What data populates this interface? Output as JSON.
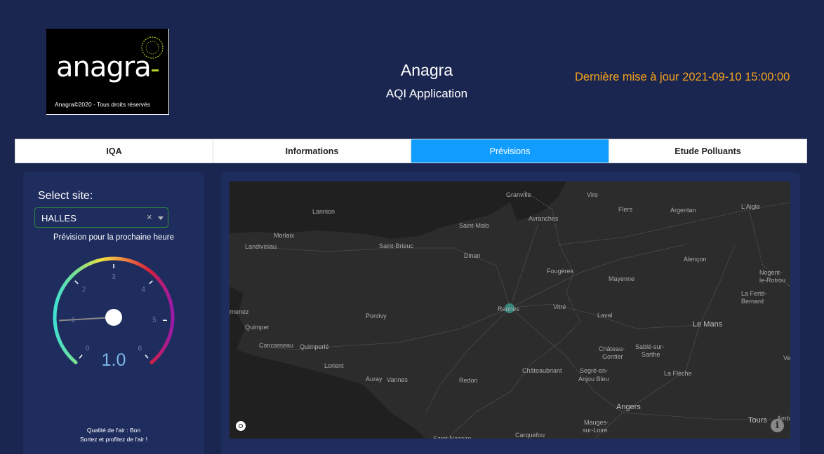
{
  "header": {
    "logo": {
      "wordmark": "anagra",
      "copyright": "Anagra©2020 -  Tous droits réservés"
    },
    "title": "Anagra",
    "subtitle": "AQI Application",
    "last_update": "Dernière mise à jour 2021-09-10 15:00:00"
  },
  "tabs": [
    {
      "label": "IQA",
      "active": false
    },
    {
      "label": "Informations",
      "active": false
    },
    {
      "label": "Prévisions",
      "active": true
    },
    {
      "label": "Etude Polluants",
      "active": false
    }
  ],
  "sidebar": {
    "select_label": "Select site:",
    "selected_site": "HALLES",
    "clear_symbol": "×",
    "forecast_label": "Prévision pour la prochaine heure",
    "gauge": {
      "min": 0,
      "max": 6,
      "ticks": [
        "0",
        "1",
        "2",
        "3",
        "4",
        "5",
        "6"
      ],
      "value": 1.0,
      "value_text": "1.0"
    },
    "quality_line1": "Qualité de l'air : Bon",
    "quality_line2": "Sortez et profitez de l'air !"
  },
  "map": {
    "cities": [
      {
        "name": "Granville"
      },
      {
        "name": "Vire"
      },
      {
        "name": "Flers"
      },
      {
        "name": "Argentan"
      },
      {
        "name": "L'Aigle"
      },
      {
        "name": "Lannion"
      },
      {
        "name": "Saint-Malo"
      },
      {
        "name": "Avranches"
      },
      {
        "name": "Morlaix"
      },
      {
        "name": "Landivisiau"
      },
      {
        "name": "Saint-Brieuc"
      },
      {
        "name": "Dinan"
      },
      {
        "name": "Alençon"
      },
      {
        "name": "Fougères"
      },
      {
        "name": "Mayenne"
      },
      {
        "name": "Nogent-"
      },
      {
        "name": "le-Rotrou"
      },
      {
        "name": "La Ferté-"
      },
      {
        "name": "Bernard"
      },
      {
        "name": "Rennes"
      },
      {
        "name": "Vitré"
      },
      {
        "name": "rnenez"
      },
      {
        "name": "Pontivy"
      },
      {
        "name": "Laval"
      },
      {
        "name": "Le Mans"
      },
      {
        "name": "Quimper"
      },
      {
        "name": "Concarneau"
      },
      {
        "name": "Quimperlé"
      },
      {
        "name": "Château-"
      },
      {
        "name": "Gontier"
      },
      {
        "name": "Sablé-sur-"
      },
      {
        "name": "Sarthe"
      },
      {
        "name": "Lorient"
      },
      {
        "name": "Châteaubriant"
      },
      {
        "name": "Segré-en-"
      },
      {
        "name": "Anjou Bleu"
      },
      {
        "name": "La Flèche"
      },
      {
        "name": "Auray"
      },
      {
        "name": "Vannes"
      },
      {
        "name": "Redon"
      },
      {
        "name": "Angers"
      },
      {
        "name": "Mauges-"
      },
      {
        "name": "sur-Loire"
      },
      {
        "name": "Tours"
      },
      {
        "name": "Carquefou"
      },
      {
        "name": "Ambo"
      },
      {
        "name": "Vel"
      },
      {
        "name": "Saint-Nazaire"
      }
    ],
    "info_symbol": "i"
  },
  "colors": {
    "background": "#1a2650",
    "panel": "#1f2d5e",
    "accent": "#119dff",
    "update": "#f5a21b",
    "gauge_value": "#7ab8e8"
  }
}
